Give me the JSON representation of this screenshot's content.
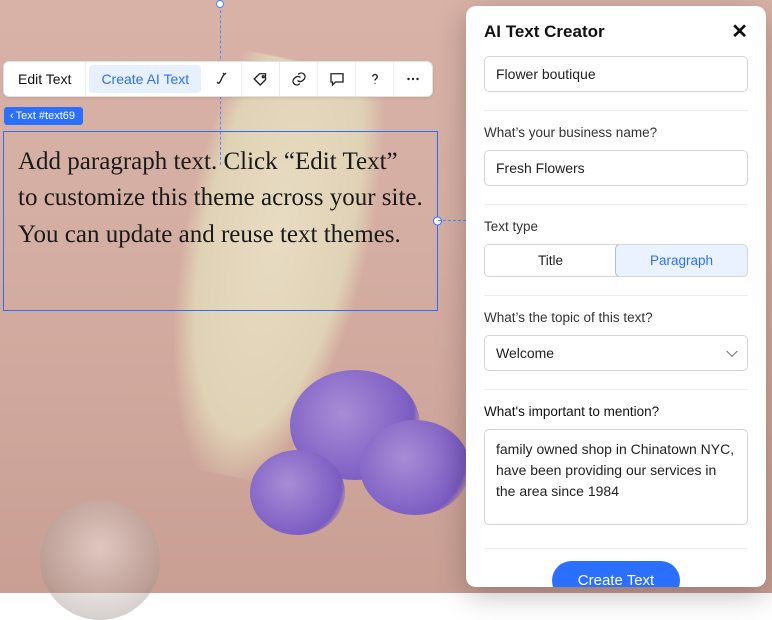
{
  "toolbar": {
    "edit_text_label": "Edit Text",
    "create_ai_text_label": "Create AI Text"
  },
  "tag_chip": {
    "label": "Text #text69"
  },
  "text_block": {
    "content": "Add paragraph text. Click “Edit Text” to customize this theme across your site. You can update and reuse text themes."
  },
  "panel": {
    "title": "AI Text Creator",
    "business_type": {
      "value": "Flower boutique"
    },
    "business_name": {
      "label": "What’s your business name?",
      "value": "Fresh Flowers"
    },
    "text_type": {
      "label": "Text type",
      "options": {
        "title": "Title",
        "paragraph": "Paragraph"
      },
      "selected": "paragraph"
    },
    "topic": {
      "label": "What’s the topic of this text?",
      "value": "Welcome"
    },
    "mention": {
      "label": "What's important to mention?",
      "value": "family owned shop in Chinatown NYC, have been providing our services in the area since 1984"
    },
    "submit_label": "Create Text"
  }
}
